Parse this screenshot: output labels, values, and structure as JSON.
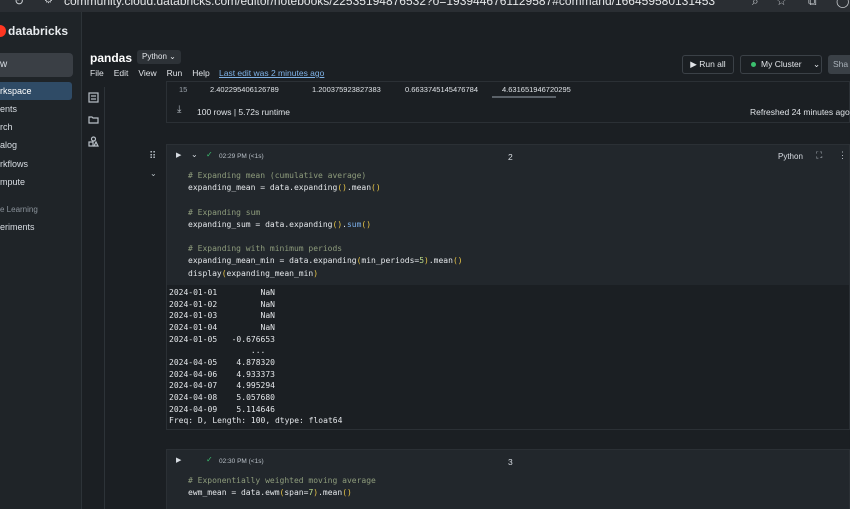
{
  "browser": {
    "url": "community.cloud.databricks.com/editor/notebooks/22535194876532?o=1939446761129587#command/166459580131453"
  },
  "sidebar": {
    "brand": "databricks",
    "new_label": "w",
    "items": [
      {
        "label": "rkspace",
        "active": true
      },
      {
        "label": "ents",
        "active": false
      },
      {
        "label": "rch",
        "active": false
      },
      {
        "label": "alog",
        "active": false
      },
      {
        "label": "rkflows",
        "active": false
      },
      {
        "label": "mpute",
        "active": false
      }
    ],
    "section_label": "e Learning",
    "section_items": [
      {
        "label": "eriments"
      }
    ]
  },
  "notebook": {
    "title": "pandas",
    "language": "Python",
    "menu": [
      "File",
      "Edit",
      "View",
      "Run",
      "Help"
    ],
    "last_edit": "Last edit was 2 minutes ago",
    "run_all": "Run all",
    "cluster": "My Cluster",
    "share": "Sha"
  },
  "prev_output": {
    "row": [
      "15",
      "2.402295406126789",
      "1.200375923827383",
      "0.6633745145476784",
      "4.631651946720295"
    ],
    "rows_info": "100 rows  |  5.72s runtime",
    "refreshed": "Refreshed 24 minutes ago"
  },
  "cell2": {
    "time": "02:29 PM (<1s)",
    "number": "2",
    "language": "Python",
    "code": [
      {
        "parts": [
          {
            "t": "# Expanding mean (cumulative average)",
            "c": "comment"
          }
        ]
      },
      {
        "parts": [
          {
            "t": "expanding_mean = data.expanding",
            "c": "text"
          },
          {
            "t": "()",
            "c": "paren"
          },
          {
            "t": ".mean",
            "c": "text"
          },
          {
            "t": "()",
            "c": "paren"
          }
        ]
      },
      {
        "parts": [
          {
            "t": "",
            "c": "text"
          }
        ]
      },
      {
        "parts": [
          {
            "t": "# Expanding sum",
            "c": "comment"
          }
        ]
      },
      {
        "parts": [
          {
            "t": "expanding_sum = data.expanding",
            "c": "text"
          },
          {
            "t": "()",
            "c": "paren"
          },
          {
            "t": ".",
            "c": "text"
          },
          {
            "t": "sum",
            "c": "fn"
          },
          {
            "t": "()",
            "c": "paren"
          }
        ]
      },
      {
        "parts": [
          {
            "t": "",
            "c": "text"
          }
        ]
      },
      {
        "parts": [
          {
            "t": "# Expanding with minimum periods",
            "c": "comment"
          }
        ]
      },
      {
        "parts": [
          {
            "t": "expanding_mean_min = data.expanding",
            "c": "text"
          },
          {
            "t": "(",
            "c": "paren"
          },
          {
            "t": "min_periods=",
            "c": "text"
          },
          {
            "t": "5",
            "c": "num"
          },
          {
            "t": ")",
            "c": "paren"
          },
          {
            "t": ".mean",
            "c": "text"
          },
          {
            "t": "()",
            "c": "paren"
          }
        ]
      },
      {
        "parts": [
          {
            "t": "display",
            "c": "text"
          },
          {
            "t": "(",
            "c": "paren"
          },
          {
            "t": "expanding_mean_min",
            "c": "text"
          },
          {
            "t": ")",
            "c": "paren"
          }
        ]
      }
    ],
    "output": [
      "2024-01-01         NaN",
      "2024-01-02         NaN",
      "2024-01-03         NaN",
      "2024-01-04         NaN",
      "2024-01-05   -0.676653",
      "                 ...",
      "2024-04-05    4.878320",
      "2024-04-06    4.933373",
      "2024-04-07    4.995294",
      "2024-04-08    5.057680",
      "2024-04-09    5.114646",
      "Freq: D, Length: 100, dtype: float64"
    ]
  },
  "cell3": {
    "time": "02:30 PM (<1s)",
    "number": "3",
    "code": [
      {
        "parts": [
          {
            "t": "# Exponentially weighted moving average",
            "c": "comment"
          }
        ]
      },
      {
        "parts": [
          {
            "t": "ewm_mean = data.ewm",
            "c": "text"
          },
          {
            "t": "(",
            "c": "paren"
          },
          {
            "t": "span=",
            "c": "text"
          },
          {
            "t": "7",
            "c": "num"
          },
          {
            "t": ")",
            "c": "paren"
          },
          {
            "t": ".mean",
            "c": "text"
          },
          {
            "t": "()",
            "c": "paren"
          }
        ]
      }
    ]
  },
  "colors": {
    "accent_red": "#ff3621",
    "active_nav": "#2f4b66",
    "link": "#7fb2e6",
    "success": "#3bbf6e"
  }
}
